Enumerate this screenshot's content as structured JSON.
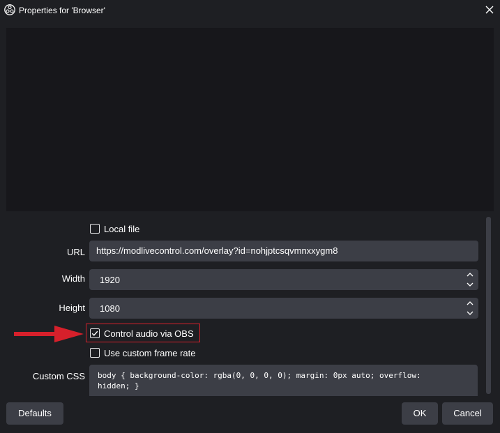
{
  "window": {
    "title": "Properties for 'Browser'",
    "app_icon": "obs-logo-icon",
    "close_icon": "close-icon"
  },
  "properties": {
    "local_file": {
      "label": "Local file",
      "checked": false
    },
    "url": {
      "label": "URL",
      "value": "https://modlivecontrol.com/overlay?id=nohjptcsqvmnxxygm8"
    },
    "width": {
      "label": "Width",
      "value": "1920"
    },
    "height": {
      "label": "Height",
      "value": "1080"
    },
    "control_audio": {
      "label": "Control audio via OBS",
      "checked": true
    },
    "custom_frame_rate": {
      "label": "Use custom frame rate",
      "checked": false
    },
    "custom_css": {
      "label": "Custom CSS",
      "line1": "body { background-color: rgba(0, 0, 0, 0); margin: 0px auto; overflow:",
      "line2": "hidden; }"
    }
  },
  "annotation": {
    "arrow_color": "#d6202b",
    "highlight_color": "#d6202b"
  },
  "buttons": {
    "defaults": "Defaults",
    "ok": "OK",
    "cancel": "Cancel"
  },
  "colors": {
    "background": "#1e1f23",
    "preview": "#17171b",
    "field": "#3c3e46",
    "text": "#ffffff"
  }
}
